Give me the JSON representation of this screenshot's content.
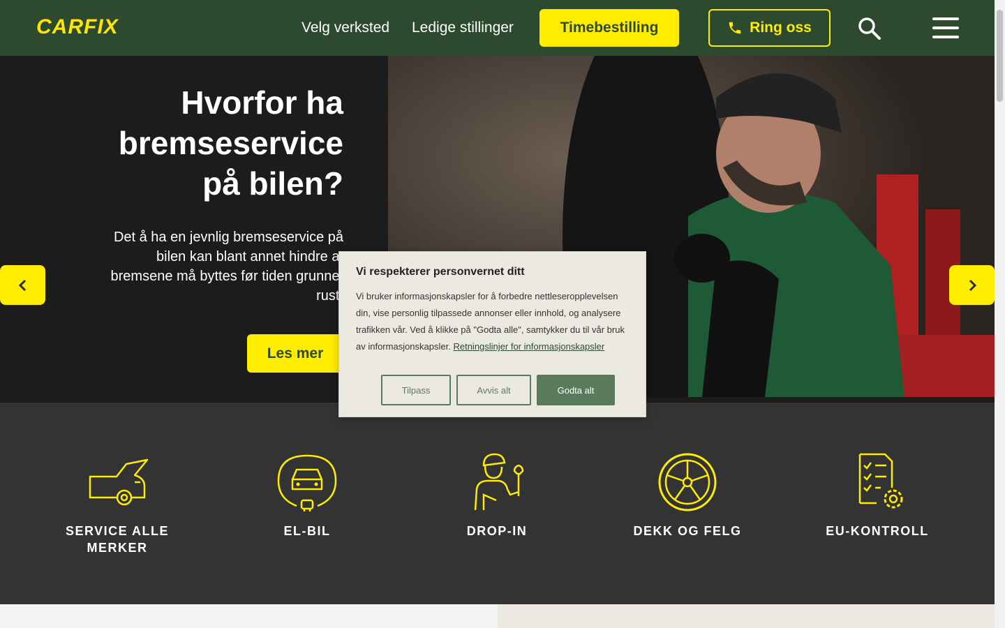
{
  "header": {
    "logo": "CARFIX",
    "nav": [
      "Velg verksted",
      "Ledige stillinger"
    ],
    "booking_label": "Timebestilling",
    "call_label": "Ring oss"
  },
  "hero": {
    "title": "Hvorfor ha bremseservice på bilen?",
    "text": "Det å ha en jevnlig bremseservice på bilen kan blant annet hindre at bremsene må byttes før tiden grunnet rust.",
    "cta": "Les mer"
  },
  "services": [
    {
      "label": "SERVICE ALLE MERKER",
      "icon": "car-service-icon"
    },
    {
      "label": "EL-BIL",
      "icon": "electric-car-icon"
    },
    {
      "label": "DROP-IN",
      "icon": "mechanic-icon"
    },
    {
      "label": "DEKK OG FELG",
      "icon": "wheel-icon"
    },
    {
      "label": "EU-KONTROLL",
      "icon": "checklist-gear-icon"
    }
  ],
  "cookie": {
    "title": "Vi respekterer personvernet ditt",
    "text": "Vi bruker informasjonskapsler for å forbedre nettleseropplevelsen din, vise personlig tilpassede annonser eller innhold, og analysere trafikken vår. Ved å klikke på \"Godta alle\", samtykker du til vår bruk av informasjonskapsler.",
    "link": "Retningslinjer for informasjonskapsler",
    "customize": "Tilpass",
    "reject": "Avvis alt",
    "accept": "Godta alt"
  },
  "colors": {
    "header_bg": "#2d4a2f",
    "accent_yellow": "#ffed00",
    "services_bg": "#333333",
    "cookie_green": "#5a7a5c"
  }
}
